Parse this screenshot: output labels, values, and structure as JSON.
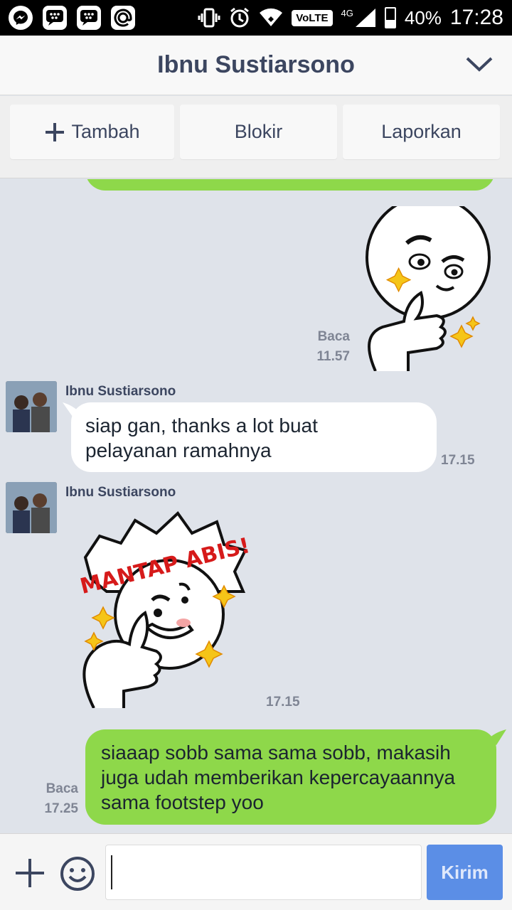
{
  "status_bar": {
    "volte": "VoLTE",
    "network": "4G",
    "battery_percent": "40%",
    "battery_level": 0.4,
    "time": "17:28",
    "left_icons": [
      "messenger-icon",
      "bbm-icon",
      "bbm-icon",
      "at-icon"
    ]
  },
  "header": {
    "title": "Ibnu Sustiarsono"
  },
  "actions": {
    "add_label": "Tambah",
    "block_label": "Blokir",
    "report_label": "Laporkan"
  },
  "messages": {
    "m1": {
      "read": "Baca",
      "time": "11.57",
      "sticker": "thumbs-up-moon-sticker"
    },
    "m2": {
      "sender": "Ibnu Sustiarsono",
      "text_line1": "siap gan, thanks a lot buat",
      "text_line2": "pelayanan ramahnya",
      "time": "17.15"
    },
    "m3": {
      "sender": "Ibnu Sustiarsono",
      "sticker_text": "MANTAP ABIS!",
      "time": "17.15"
    },
    "m4": {
      "read": "Baca",
      "time": "17.25",
      "text_line1": "siaaap sobb sama sama sobb, makasih",
      "text_line2": "juga udah memberikan kepercayaannya",
      "text_line3": "sama footstep yoo"
    }
  },
  "input": {
    "placeholder": "",
    "send_label": "Kirim"
  },
  "colors": {
    "own_bubble": "#8ed84a",
    "other_bubble": "#ffffff",
    "chat_background": "#dfe3ea",
    "send_button": "#5b8ee6",
    "title_text": "#3c4660"
  }
}
